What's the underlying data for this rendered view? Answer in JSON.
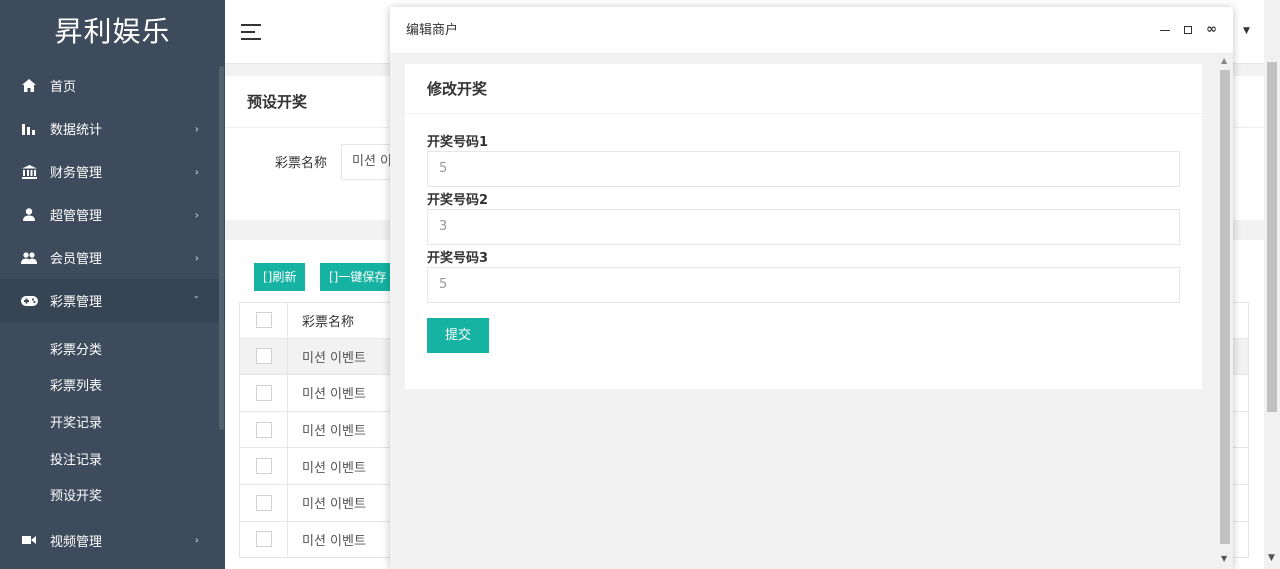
{
  "sidebar": {
    "logo": "昇利娱乐",
    "items": [
      {
        "label": "首页",
        "icon": "home-icon"
      },
      {
        "label": "数据统计",
        "icon": "bar-chart-icon"
      },
      {
        "label": "财务管理",
        "icon": "bank-icon"
      },
      {
        "label": "超管管理",
        "icon": "user-icon"
      },
      {
        "label": "会员管理",
        "icon": "users-icon"
      },
      {
        "label": "彩票管理",
        "icon": "gamepad-icon"
      }
    ],
    "lottery_submenu": [
      "彩票分类",
      "彩票列表",
      "开奖记录",
      "投注记录",
      "预设开奖"
    ],
    "video_item": {
      "label": "视频管理",
      "icon": "video-icon"
    }
  },
  "page": {
    "title": "预设开奖",
    "filter_label": "彩票名称",
    "filter_value": "미션 이",
    "refresh_button": "刷新",
    "save_all_button": "一键保存",
    "table_header": "彩票名称",
    "rows": [
      "미션 이벤트",
      "미션 이벤트",
      "미션 이벤트",
      "미션 이벤트",
      "미션 이벤트",
      "미션 이벤트"
    ]
  },
  "modal": {
    "title": "编辑商户",
    "form_title": "修改开奖",
    "fields": [
      {
        "label": "开奖号码1",
        "value": "5"
      },
      {
        "label": "开奖号码2",
        "value": "3"
      },
      {
        "label": "开奖号码3",
        "value": "5"
      }
    ],
    "submit": "提交"
  },
  "colors": {
    "sidebar_bg": "#3d4b5c",
    "accent_teal": "#16b3a2"
  }
}
